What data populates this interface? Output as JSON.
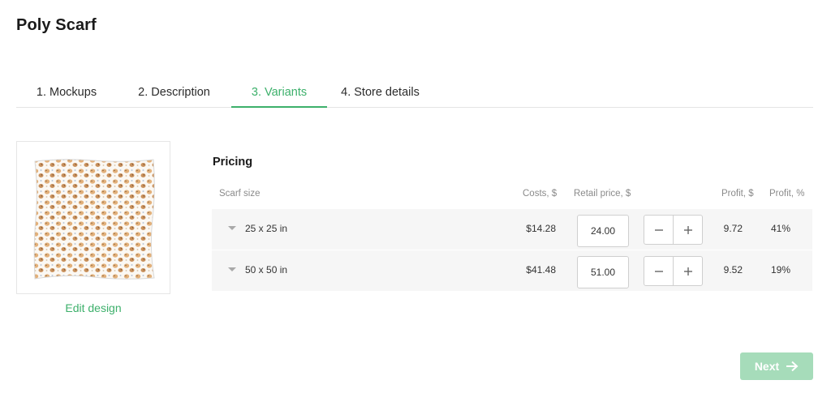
{
  "page": {
    "title": "Poly Scarf"
  },
  "tabs": [
    {
      "label": "1. Mockups"
    },
    {
      "label": "2. Description"
    },
    {
      "label": "3. Variants"
    },
    {
      "label": "4. Store details"
    }
  ],
  "active_tab": "3. Variants",
  "preview": {
    "edit_label": "Edit design"
  },
  "pricing": {
    "title": "Pricing",
    "headers": {
      "size": "Scarf size",
      "costs": "Costs, $",
      "retail": "Retail price, $",
      "profit_usd": "Profit, $",
      "profit_pct": "Profit, %"
    },
    "rows": [
      {
        "size": "25 x 25 in",
        "cost": "$14.28",
        "retail": "24.00",
        "profit_usd": "9.72",
        "profit_pct": "41%"
      },
      {
        "size": "50 x 50 in",
        "cost": "$41.48",
        "retail": "51.00",
        "profit_usd": "9.52",
        "profit_pct": "19%"
      }
    ]
  },
  "footer": {
    "next_label": "Next"
  },
  "colors": {
    "accent": "#3db06b",
    "next_disabled": "#a6dcba",
    "row_bg": "#f6f6f6"
  },
  "icons": [
    "caret-down-icon",
    "minus-icon",
    "plus-icon",
    "arrow-right-icon"
  ]
}
